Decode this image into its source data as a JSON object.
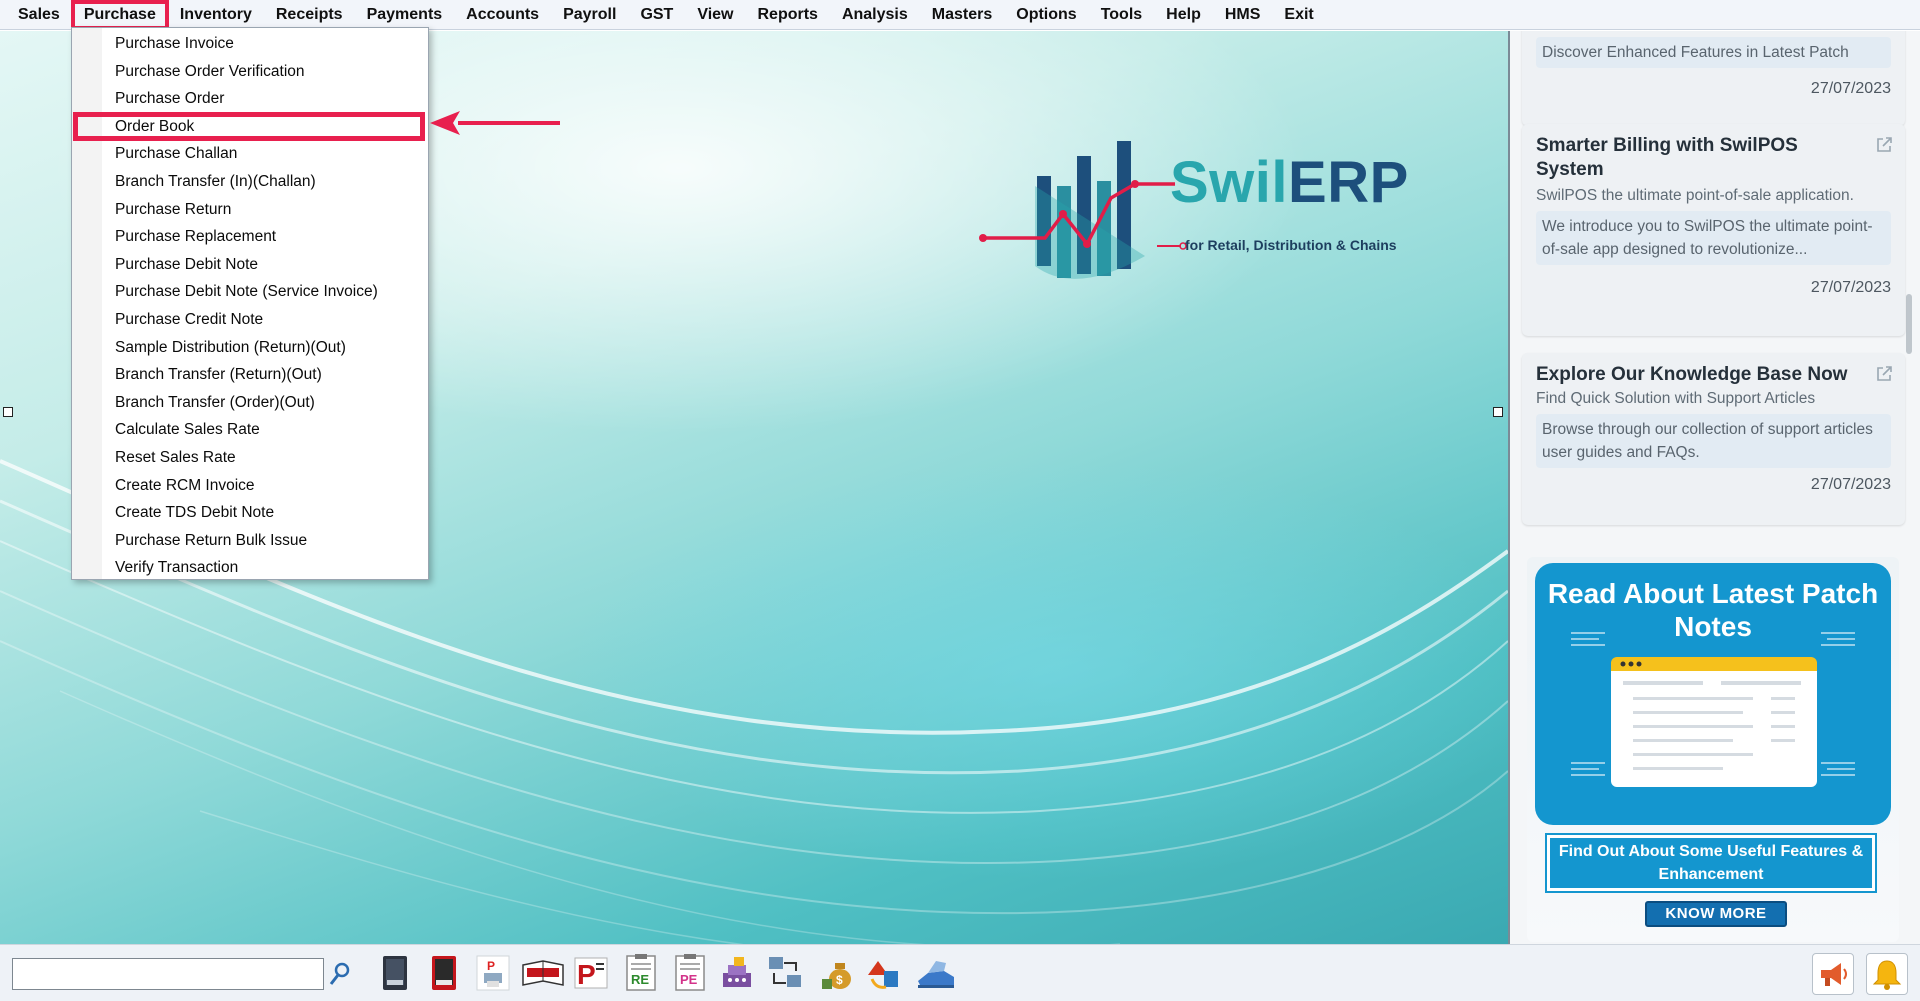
{
  "menubar": {
    "items": [
      "Sales",
      "Purchase",
      "Inventory",
      "Receipts",
      "Payments",
      "Accounts",
      "Payroll",
      "GST",
      "View",
      "Reports",
      "Analysis",
      "Masters",
      "Options",
      "Tools",
      "Help",
      "HMS",
      "Exit"
    ],
    "active": "Purchase"
  },
  "purchase_menu": {
    "items": [
      "Purchase Invoice",
      "Purchase Order Verification",
      "Purchase Order",
      "Order Book",
      "Purchase Challan",
      "Branch Transfer (In)(Challan)",
      "Purchase Return",
      "Purchase Replacement",
      "Purchase Debit Note",
      "Purchase Debit Note (Service Invoice)",
      "Purchase Credit Note",
      "Sample Distribution (Return)(Out)",
      "Branch Transfer (Return)(Out)",
      "Branch Transfer (Order)(Out)",
      "Calculate Sales Rate",
      "Reset Sales Rate",
      "Create RCM Invoice",
      "Create TDS Debit Note",
      "Purchase Return Bulk Issue",
      "Verify Transaction"
    ],
    "highlighted": "Order Book"
  },
  "logo": {
    "word_swil": "Swil",
    "word_erp": "ERP",
    "tagline": "for Retail, Distribution & Chains"
  },
  "news": {
    "card0": {
      "body": "Discover Enhanced Features in Latest Patch",
      "date": "27/07/2023"
    },
    "card1": {
      "title": "Smarter Billing with SwilPOS System",
      "subtitle": "SwilPOS the ultimate point-of-sale application.",
      "body": "We introduce you to SwilPOS the ultimate point-of-sale app designed to revolutionize...",
      "date": "27/07/2023"
    },
    "card2": {
      "title": "Explore Our Knowledge Base Now",
      "subtitle": "Find Quick Solution with Support Articles",
      "body": "Browse through our collection of support articles user guides and FAQs.",
      "date": "27/07/2023"
    }
  },
  "promo": {
    "title": "Read About Latest Patch Notes",
    "feature_text": "Find Out About Some Useful Features & Enhancement",
    "button_label": "KNOW MORE"
  },
  "bottom": {
    "search_value": "",
    "toolbar_icons": [
      "ledger-book-icon",
      "red-ledger-book-icon",
      "printer-p-icon",
      "order-book-icon",
      "purchase-p-icon",
      "receipt-re-icon",
      "purchase-pe-icon",
      "cash-register-icon",
      "transfer-icon",
      "money-bag-icon",
      "arrows-exchange-icon",
      "shoe-scanner-icon"
    ],
    "corner_icons": [
      "announcement-icon",
      "notification-bell-icon"
    ]
  },
  "colors": {
    "highlight": "#e8204e",
    "brand_teal": "#29a6ad",
    "brand_navy": "#1d4f7c",
    "promo_blue": "#1496cf"
  }
}
